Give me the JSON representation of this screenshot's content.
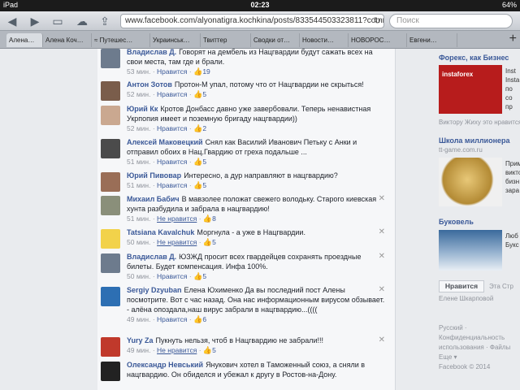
{
  "status": {
    "device": "iPad",
    "time": "02:23",
    "battery": "64%"
  },
  "browser": {
    "url": "www.facebook.com/alyonatigra.kochkina/posts/833544503323811?comm",
    "search_placeholder": "Поиск",
    "tabs": [
      "Алена…",
      "Алена Коч…",
      "≈ Путешес…",
      "Украинськ…",
      "Твиттер",
      "Сводки от…",
      "Новости…",
      "НОВОРОС…",
      "Евгени…"
    ]
  },
  "comments": [
    {
      "author": "Владислав Д.",
      "text": "Говорят на дембель из Нацгвардии будут сажать всех на свои места, там где и брали.",
      "time": "53 мин.",
      "action": "Нравится",
      "likes": "19"
    },
    {
      "author": "Антон Зотов",
      "text": "Протон-М упал, потому что от Нацгвардии не скрыться!",
      "time": "52 мин.",
      "action": "Нравится",
      "likes": "5"
    },
    {
      "author": "Юрий Кк",
      "text": "Кротов Донбасс давно уже завербовали. Теперь ненавистная Укрпопия имеет и поземную бригаду нацгвардии))",
      "time": "52 мин.",
      "action": "Нравится",
      "likes": "2"
    },
    {
      "author": "Алексей Маковецкий",
      "text": "Снял как Василий Иванович Петьку с Анки и отправил обоих в Нац.Гвардию от греха подальше ...",
      "time": "51 мин.",
      "action": "Нравится",
      "likes": "5"
    },
    {
      "author": "Юрий Пивовар",
      "text": "Интересно, а дур направляют в нацгвардию?",
      "time": "51 мин.",
      "action": "Нравится",
      "likes": "5"
    },
    {
      "author": "Михаил Бабич",
      "text": "В мавзолее положат свежего володьку. Старого киевская хунта разбудила и забрала в нацгвардию!",
      "time": "51 мин.",
      "action": "Не нравится",
      "likes": "8"
    },
    {
      "author": "Tatsiana Kavalchuk",
      "text": "Моргнула - а уже в Нацгвардии.",
      "time": "50 мин.",
      "action": "Не нравится",
      "likes": "5"
    },
    {
      "author": "Владислав Д.",
      "text": "ЮЗЖД просит всех гвардейцев сохранять проездные билеты. Будет компенсация. Инфа 100%.",
      "time": "50 мин.",
      "action": "Нравится",
      "likes": "5"
    },
    {
      "author": "Sergiy Dzyuban",
      "text": "Елена Юхименко Да вы последний пост Алены посмотрите. Вот с час назад. Она нас информационным вирусом обзывает. - алёна опоздала,наш вирус забрали в нацгвардию...((((",
      "time": "49 мин.",
      "action": "Нравится",
      "likes": "6"
    },
    {
      "author": "Yury Za",
      "text": "Пукнуть нельзя, чтоб в Нацгвардию не забрали!!!",
      "time": "49 мин.",
      "action": "Не нравится",
      "likes": "5"
    },
    {
      "author": "Олександр Невський",
      "text": "Янукович хотел в Таможенный союз, а сняли в нацгвардию. Он обиделся и убежал к другу в Ростов-на-Дону.",
      "time": "",
      "action": "",
      "likes": ""
    }
  ],
  "sidebar": {
    "ad1": {
      "title": "Форекс, как Бизнес",
      "side": "Inst\nInsta\nпо\nсо\nпр",
      "foot": "Виктору Жиху это нравится",
      "img_caption": "instaforex"
    },
    "ad2": {
      "title": "Школа миллионера",
      "domain": "tt-game.com.ru",
      "side": "Прим\nвикто\nбизн\nзара"
    },
    "ad3": {
      "title": "Буковель",
      "side": "Люб\nБукс"
    },
    "like_button": "Нравится",
    "like_note": "Эта Стр",
    "like_foot": "Елене Шкарповой",
    "footer": [
      "Русский · Конфиденциальность",
      "использования · Файлы",
      "Еще ▾",
      "Facebook © 2014"
    ]
  },
  "colors": {
    "link": "#3b5998",
    "text": "#1d2129",
    "meta": "#90949c"
  }
}
